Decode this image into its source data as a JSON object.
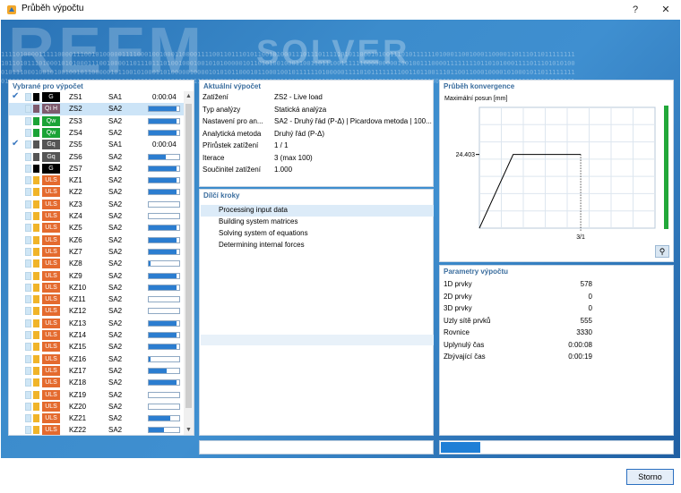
{
  "window": {
    "title": "Průběh výpočtu",
    "help_label": "?",
    "close_label": "✕"
  },
  "banner": {
    "brand1": "REFM",
    "brand2": "SOLVER",
    "binary_lines": [
      "11110100001111100001110010100000111100010010001100001111001101110101100101000111011101111101011000101001110101111110100011001000110000110111011011111111",
      "10110101110100010101000111001000011011101110100100010010101000001011010100100011001101110011111100000000011010011100001111111101101010001111011101010100",
      "01011100010010100100101100000101100101000110100000100001010101100010110001001011111101000001111010111111110011011001110110011000100001010001011011111111",
      "01111100100111111000100010111001101110111010000111011100100101101101001000110101011011000100111110110111111110101100111101110000111000001110011111100101"
    ],
    "colors": {
      "accent_blue": "#2b7dd0",
      "panel_title": "#3a6d9e",
      "conv_green": "#22a83a"
    }
  },
  "left_panel": {
    "title": "Vybrané pro výpočet",
    "rows": [
      {
        "checked": true,
        "tag": "G",
        "tag_color": "#000000",
        "sw": "#000000",
        "name": "ZS1",
        "solver": "SA1",
        "time": "0:00:04",
        "progress": null,
        "selected": false
      },
      {
        "checked": false,
        "tag": "Qi H",
        "tag_color": "#7d5a6e",
        "sw": "#7d5a6e",
        "name": "ZS2",
        "solver": "SA2",
        "time": null,
        "progress": 0.9,
        "selected": true
      },
      {
        "checked": false,
        "tag": "Qw",
        "tag_color": "#1aa336",
        "sw": "#1aa336",
        "name": "ZS3",
        "solver": "SA2",
        "time": null,
        "progress": 0.9,
        "selected": false
      },
      {
        "checked": false,
        "tag": "Qw",
        "tag_color": "#1aa336",
        "sw": "#1aa336",
        "name": "ZS4",
        "solver": "SA2",
        "time": null,
        "progress": 0.9,
        "selected": false
      },
      {
        "checked": true,
        "tag": "Gq",
        "tag_color": "#555555",
        "sw": "#555555",
        "name": "ZS5",
        "solver": "SA1",
        "time": "0:00:04",
        "progress": null,
        "selected": false
      },
      {
        "checked": false,
        "tag": "Gq",
        "tag_color": "#555555",
        "sw": "#555555",
        "name": "ZS6",
        "solver": "SA2",
        "time": null,
        "progress": 0.55,
        "selected": false
      },
      {
        "checked": false,
        "tag": "G",
        "tag_color": "#000000",
        "sw": "#000000",
        "name": "ZS7",
        "solver": "SA2",
        "time": null,
        "progress": 0.9,
        "selected": false
      },
      {
        "checked": false,
        "tag": "ULS",
        "tag_color": "#e46a2e",
        "sw": "#f0b429",
        "name": "KZ1",
        "solver": "SA2",
        "time": null,
        "progress": 0.9,
        "selected": false
      },
      {
        "checked": false,
        "tag": "ULS",
        "tag_color": "#e46a2e",
        "sw": "#f0b429",
        "name": "KZ2",
        "solver": "SA2",
        "time": null,
        "progress": 0.9,
        "selected": false
      },
      {
        "checked": false,
        "tag": "ULS",
        "tag_color": "#e46a2e",
        "sw": "#f0b429",
        "name": "KZ3",
        "solver": "SA2",
        "time": null,
        "progress": null,
        "selected": false
      },
      {
        "checked": false,
        "tag": "ULS",
        "tag_color": "#e46a2e",
        "sw": "#f0b429",
        "name": "KZ4",
        "solver": "SA2",
        "time": null,
        "progress": null,
        "selected": false
      },
      {
        "checked": false,
        "tag": "ULS",
        "tag_color": "#e46a2e",
        "sw": "#f0b429",
        "name": "KZ5",
        "solver": "SA2",
        "time": null,
        "progress": 0.9,
        "selected": false
      },
      {
        "checked": false,
        "tag": "ULS",
        "tag_color": "#e46a2e",
        "sw": "#f0b429",
        "name": "KZ6",
        "solver": "SA2",
        "time": null,
        "progress": 0.9,
        "selected": false
      },
      {
        "checked": false,
        "tag": "ULS",
        "tag_color": "#e46a2e",
        "sw": "#f0b429",
        "name": "KZ7",
        "solver": "SA2",
        "time": null,
        "progress": 0.9,
        "selected": false
      },
      {
        "checked": false,
        "tag": "ULS",
        "tag_color": "#e46a2e",
        "sw": "#f0b429",
        "name": "KZ8",
        "solver": "SA2",
        "time": null,
        "progress": 0.05,
        "selected": false
      },
      {
        "checked": false,
        "tag": "ULS",
        "tag_color": "#e46a2e",
        "sw": "#f0b429",
        "name": "KZ9",
        "solver": "SA2",
        "time": null,
        "progress": 0.9,
        "selected": false
      },
      {
        "checked": false,
        "tag": "ULS",
        "tag_color": "#e46a2e",
        "sw": "#f0b429",
        "name": "KZ10",
        "solver": "SA2",
        "time": null,
        "progress": 0.9,
        "selected": false
      },
      {
        "checked": false,
        "tag": "ULS",
        "tag_color": "#e46a2e",
        "sw": "#f0b429",
        "name": "KZ11",
        "solver": "SA2",
        "time": null,
        "progress": null,
        "selected": false
      },
      {
        "checked": false,
        "tag": "ULS",
        "tag_color": "#e46a2e",
        "sw": "#f0b429",
        "name": "KZ12",
        "solver": "SA2",
        "time": null,
        "progress": null,
        "selected": false
      },
      {
        "checked": false,
        "tag": "ULS",
        "tag_color": "#e46a2e",
        "sw": "#f0b429",
        "name": "KZ13",
        "solver": "SA2",
        "time": null,
        "progress": 0.9,
        "selected": false
      },
      {
        "checked": false,
        "tag": "ULS",
        "tag_color": "#e46a2e",
        "sw": "#f0b429",
        "name": "KZ14",
        "solver": "SA2",
        "time": null,
        "progress": 0.9,
        "selected": false
      },
      {
        "checked": false,
        "tag": "ULS",
        "tag_color": "#e46a2e",
        "sw": "#f0b429",
        "name": "KZ15",
        "solver": "SA2",
        "time": null,
        "progress": 0.9,
        "selected": false
      },
      {
        "checked": false,
        "tag": "ULS",
        "tag_color": "#e46a2e",
        "sw": "#f0b429",
        "name": "KZ16",
        "solver": "SA2",
        "time": null,
        "progress": 0.05,
        "selected": false
      },
      {
        "checked": false,
        "tag": "ULS",
        "tag_color": "#e46a2e",
        "sw": "#f0b429",
        "name": "KZ17",
        "solver": "SA2",
        "time": null,
        "progress": 0.6,
        "selected": false
      },
      {
        "checked": false,
        "tag": "ULS",
        "tag_color": "#e46a2e",
        "sw": "#f0b429",
        "name": "KZ18",
        "solver": "SA2",
        "time": null,
        "progress": 0.9,
        "selected": false
      },
      {
        "checked": false,
        "tag": "ULS",
        "tag_color": "#e46a2e",
        "sw": "#f0b429",
        "name": "KZ19",
        "solver": "SA2",
        "time": null,
        "progress": null,
        "selected": false
      },
      {
        "checked": false,
        "tag": "ULS",
        "tag_color": "#e46a2e",
        "sw": "#f0b429",
        "name": "KZ20",
        "solver": "SA2",
        "time": null,
        "progress": null,
        "selected": false
      },
      {
        "checked": false,
        "tag": "ULS",
        "tag_color": "#e46a2e",
        "sw": "#f0b429",
        "name": "KZ21",
        "solver": "SA2",
        "time": null,
        "progress": 0.7,
        "selected": false
      },
      {
        "checked": false,
        "tag": "ULS",
        "tag_color": "#e46a2e",
        "sw": "#f0b429",
        "name": "KZ22",
        "solver": "SA2",
        "time": null,
        "progress": 0.5,
        "selected": false
      }
    ]
  },
  "current": {
    "title": "Aktuální výpočet",
    "rows": [
      {
        "k": "Zatížení",
        "v": "ZS2 - Live load"
      },
      {
        "k": "Typ analýzy",
        "v": "Statická analýza"
      },
      {
        "k": "Nastavení pro an...",
        "v": "SA2 - Druhý řád (P-Δ) | Picardova metoda | 100..."
      },
      {
        "k": "Analytická metoda",
        "v": "Druhý řád (P-Δ)"
      },
      {
        "k": "Přírůstek zatížení",
        "v": "1 / 1"
      },
      {
        "k": "Iterace",
        "v": "3 (max 100)"
      },
      {
        "k": "Součinitel zatížení",
        "v": "1.000"
      }
    ]
  },
  "steps": {
    "title": "Dílčí kroky",
    "items": [
      "Processing input data",
      "Building system matrices",
      "Solving system of equations",
      "Determining internal forces"
    ]
  },
  "convergence": {
    "title": "Průběh konvergence",
    "chart_data": {
      "type": "line",
      "ylabel": "Maximální posun [mm]",
      "x_tick_label": "3/1",
      "y_tick_label": "24.403",
      "x": [
        0,
        1,
        2,
        3
      ],
      "values": [
        0,
        24.403,
        24.403,
        24.403
      ],
      "ylim": [
        0,
        40
      ],
      "grid": true
    },
    "zoom_icon": "zoom-icon"
  },
  "params": {
    "title": "Parametry výpočtu",
    "rows": [
      {
        "k": "1D prvky",
        "v": "578"
      },
      {
        "k": "2D prvky",
        "v": "0"
      },
      {
        "k": "3D prvky",
        "v": "0"
      },
      {
        "k": "Uzly sítě prvků",
        "v": "555"
      },
      {
        "k": "Rovnice",
        "v": "3330"
      },
      {
        "k": "Uplynulý čas",
        "v": "0:00:08"
      },
      {
        "k": "Zbývající čas",
        "v": "0:00:19"
      }
    ]
  },
  "progress": {
    "left": 0.0,
    "right": 0.17
  },
  "buttons": {
    "cancel": "Storno"
  }
}
